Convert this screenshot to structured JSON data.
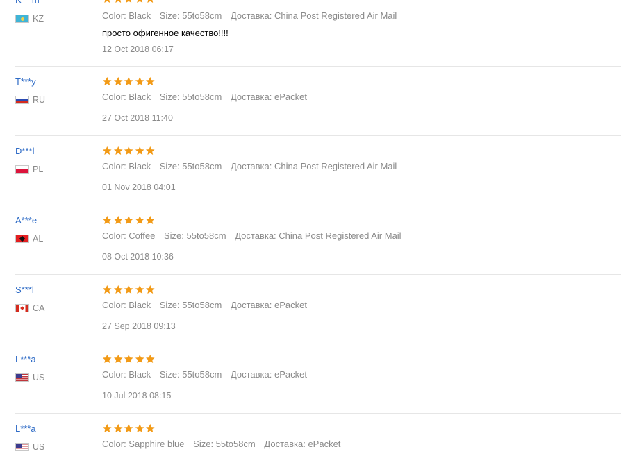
{
  "colors": {
    "star": "#f29a16",
    "buyer_name": "#2e6bc6",
    "meta_text": "#8a8a8a",
    "divider": "#e6e6e6"
  },
  "reviews": [
    {
      "buyer": "K***m",
      "country_code": "KZ",
      "flag_icon": "kazakhstan-flag-icon",
      "rating": 5,
      "color": "Color: Black",
      "size": "Size: 55to58cm",
      "shipping": "Доставка: China Post Registered Air Mail",
      "text": "просто офигенное качество!!!!",
      "date": "12 Oct 2018 06:17"
    },
    {
      "buyer": "T***y",
      "country_code": "RU",
      "flag_icon": "russia-flag-icon",
      "rating": 5,
      "color": "Color: Black",
      "size": "Size: 55to58cm",
      "shipping": "Доставка: ePacket",
      "text": "",
      "date": "27 Oct 2018 11:40"
    },
    {
      "buyer": "D***l",
      "country_code": "PL",
      "flag_icon": "poland-flag-icon",
      "rating": 5,
      "color": "Color: Black",
      "size": "Size: 55to58cm",
      "shipping": "Доставка: China Post Registered Air Mail",
      "text": "",
      "date": "01 Nov 2018 04:01"
    },
    {
      "buyer": "A***e",
      "country_code": "AL",
      "flag_icon": "albania-flag-icon",
      "rating": 5,
      "color": "Color: Coffee",
      "size": "Size: 55to58cm",
      "shipping": "Доставка: China Post Registered Air Mail",
      "text": "",
      "date": "08 Oct 2018 10:36"
    },
    {
      "buyer": "S***l",
      "country_code": "CA",
      "flag_icon": "canada-flag-icon",
      "rating": 5,
      "color": "Color: Black",
      "size": "Size: 55to58cm",
      "shipping": "Доставка: ePacket",
      "text": "",
      "date": "27 Sep 2018 09:13"
    },
    {
      "buyer": "L***a",
      "country_code": "US",
      "flag_icon": "usa-flag-icon",
      "rating": 5,
      "color": "Color: Black",
      "size": "Size: 55to58cm",
      "shipping": "Доставка: ePacket",
      "text": "",
      "date": "10 Jul 2018 08:15"
    },
    {
      "buyer": "L***a",
      "country_code": "US",
      "flag_icon": "usa-flag-icon",
      "rating": 5,
      "color": "Color: Sapphire blue",
      "size": "Size: 55to58cm",
      "shipping": "Доставка: ePacket",
      "text": "",
      "date": ""
    }
  ]
}
